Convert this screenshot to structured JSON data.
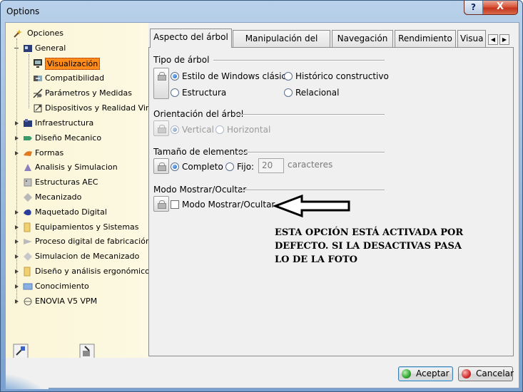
{
  "window": {
    "title": "Options",
    "help_label": "?",
    "close_label": "X"
  },
  "tree": {
    "root": {
      "label": "Opciones",
      "icon": "options-wand-icon"
    },
    "general": {
      "label": "General",
      "icon": "general-icon",
      "children": [
        {
          "label": "Visualización",
          "icon": "monitor-icon",
          "selected": true
        },
        {
          "label": "Compatibilidad",
          "icon": "compatibility-icon"
        },
        {
          "label": "Parámetros y Medidas",
          "icon": "parameters-icon"
        },
        {
          "label": "Dispositivos y Realidad Virtu",
          "icon": "devices-icon"
        }
      ]
    },
    "categories": [
      {
        "label": "Infraestructura",
        "icon": "infrastructure-icon",
        "expandable": true
      },
      {
        "label": "Diseño Mecanico",
        "icon": "mechanical-design-icon",
        "expandable": true
      },
      {
        "label": "Formas",
        "icon": "shapes-icon",
        "expandable": true
      },
      {
        "label": "Analisis y Simulacion",
        "icon": "analysis-icon",
        "expandable": false
      },
      {
        "label": "Estructuras AEC",
        "icon": "aec-icon",
        "expandable": false
      },
      {
        "label": "Mecanizado",
        "icon": "machining-icon",
        "expandable": false
      },
      {
        "label": "Maquetado Digital",
        "icon": "digital-mockup-icon",
        "expandable": true
      },
      {
        "label": "Equipamientos y Sistemas",
        "icon": "equipment-icon",
        "expandable": true
      },
      {
        "label": "Proceso digital de fabricación",
        "icon": "digital-process-icon",
        "expandable": true
      },
      {
        "label": "Simulacion de Mecanizado",
        "icon": "machining-sim-icon",
        "expandable": true
      },
      {
        "label": "Diseño y análisis ergonómico:",
        "icon": "ergonomics-icon",
        "expandable": true
      },
      {
        "label": "Conocimiento",
        "icon": "knowledge-icon",
        "expandable": true
      },
      {
        "label": "ENOVIA V5 VPM",
        "icon": "enovia-icon",
        "expandable": true
      }
    ]
  },
  "tabs": [
    {
      "label": "Aspecto del árbol",
      "active": true
    },
    {
      "label": "Manipulación del árbol",
      "active": false
    },
    {
      "label": "Navegación",
      "active": false
    },
    {
      "label": "Rendimiento",
      "active": false
    },
    {
      "label": "Visua",
      "active": false
    }
  ],
  "panel": {
    "tree_type": {
      "title": "Tipo de árbol",
      "options": [
        {
          "label": "Estilo de Windows clásico",
          "checked": true
        },
        {
          "label": "Histórico constructivo",
          "checked": false
        },
        {
          "label": "Estructura",
          "checked": false
        },
        {
          "label": "Relacional",
          "checked": false
        }
      ]
    },
    "orientation": {
      "title": "Orientación del árbol",
      "options": [
        {
          "label": "Vertical",
          "checked": true,
          "disabled": true
        },
        {
          "label": "Horizontal",
          "checked": false,
          "disabled": true
        }
      ]
    },
    "element_size": {
      "title": "Tamaño de elementos",
      "complete_label": "Completo",
      "fixed_label": "Fijo:",
      "fixed_value": "20",
      "unit_label": "caracteres"
    },
    "show_hide": {
      "title": "Modo Mostrar/Ocultar",
      "checkbox_label": "Modo Mostrar/Ocultar",
      "checked": false
    }
  },
  "annotation": {
    "lines": [
      "ESTA OPCIÓN ESTÁ ACTIVADA POR",
      "DEFECTO. SI LA DESACTIVAS PASA",
      "LO DE LA FOTO"
    ]
  },
  "buttons": {
    "accept_label": "Aceptar",
    "cancel_label": "Cancelar"
  },
  "colors": {
    "selection": "#ff8c1a",
    "accept_dot": "#2fa52f",
    "cancel_dot": "#d42a2a"
  }
}
